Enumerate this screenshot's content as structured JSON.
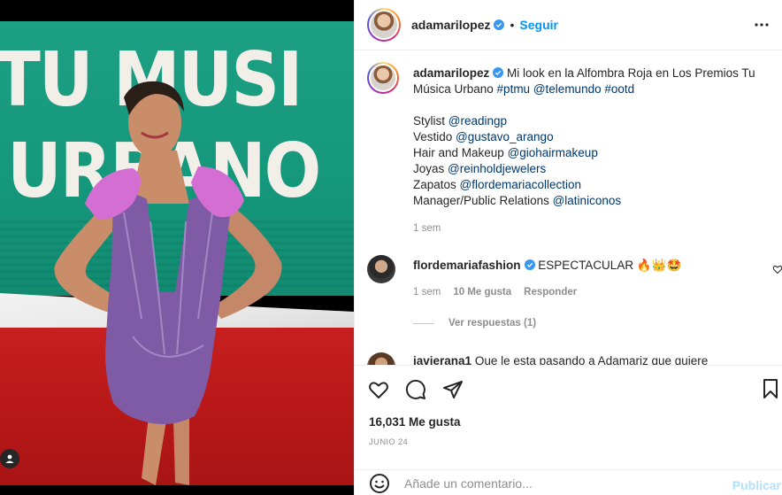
{
  "post": {
    "author": "adamarilopez",
    "follow_label": "Seguir",
    "separator": "•",
    "more_icon": "more-horizontal-icon"
  },
  "photo": {
    "banner_lines": [
      "TU MUSI",
      "URBANO"
    ]
  },
  "caption": {
    "author": "adamarilopez",
    "text_1": "Mi look en la Alfombra Roja en Los Premios Tu Música Urbano ",
    "tags_1": [
      "#ptmu",
      "@telemundo",
      "#ootd"
    ],
    "credits": [
      {
        "label": "Stylist ",
        "tag": "@readingp"
      },
      {
        "label": "Vestido ",
        "tag": "@gustavo_arango"
      },
      {
        "label": "Hair and Makeup ",
        "tag": "@giohairmakeup"
      },
      {
        "label": "Joyas ",
        "tag": "@reinholdjewelers"
      },
      {
        "label": "Zapatos ",
        "tag": "@flordemariacollection"
      },
      {
        "label": "Manager/Public Relations ",
        "tag": "@latiniconos"
      }
    ],
    "time": "1 sem"
  },
  "comments": [
    {
      "author": "flordemariafashion",
      "text": "ESPECTACULAR 🔥👑🤩",
      "time": "1 sem",
      "likes": "10 Me gusta",
      "reply_label": "Responder",
      "view_replies": "Ver respuestas (1)"
    },
    {
      "author": "javierana1",
      "text": "Que le esta pasando a Adamariz que quiere"
    }
  ],
  "actions": {
    "likes": "16,031 Me gusta",
    "date": "JUNIO 24"
  },
  "add_comment": {
    "placeholder": "Añade un comentario...",
    "publish_label": "Publicar"
  },
  "colors": {
    "link": "#0095f6",
    "tag": "#00376b",
    "muted": "#8e8e8e",
    "publish_disabled": "#b2dffc"
  }
}
